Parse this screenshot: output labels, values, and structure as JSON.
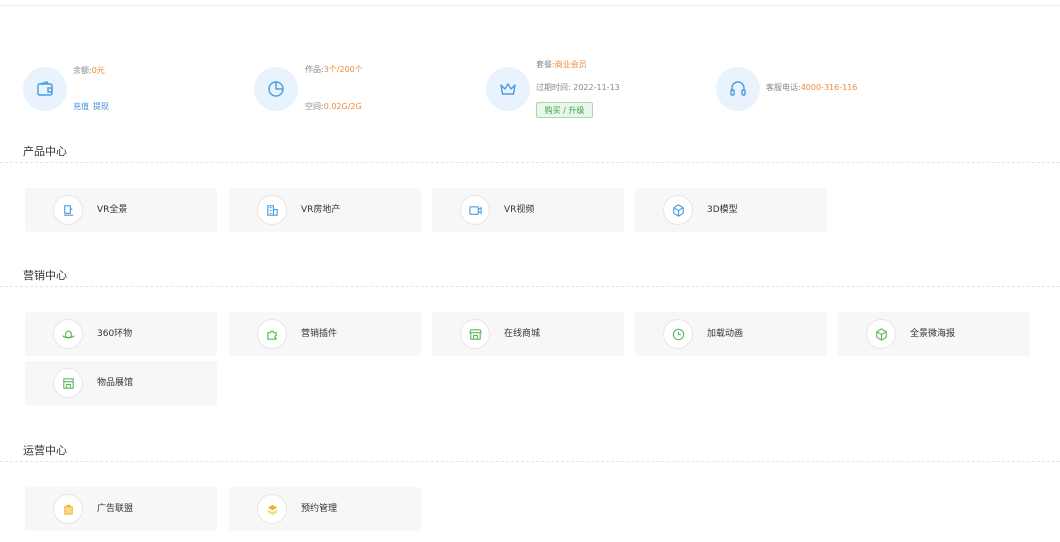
{
  "stats": {
    "balance": {
      "label": "余额:",
      "value": "0元",
      "links": [
        "充值",
        "提现"
      ]
    },
    "works": {
      "works_label": "作品:",
      "works_value": "3个/200个",
      "space_label": "空间:",
      "space_value": "0.02G/2G"
    },
    "package": {
      "label": "套餐:",
      "value": "商业会员",
      "expire_label": "过期时间:",
      "expire_value": "2022-11-13",
      "button": "购买 / 升级"
    },
    "service": {
      "label": "客服电话:",
      "value": "4000-316-116"
    }
  },
  "sections": {
    "product": {
      "title": "产品中心",
      "items": [
        {
          "label": "VR全景",
          "icon": "vr-panorama-icon"
        },
        {
          "label": "VR房地产",
          "icon": "building-icon"
        },
        {
          "label": "VR视频",
          "icon": "video-icon"
        },
        {
          "label": "3D模型",
          "icon": "cube-icon"
        }
      ]
    },
    "marketing": {
      "title": "营销中心",
      "items": [
        {
          "label": "360环物",
          "icon": "rotate-object-icon"
        },
        {
          "label": "营销插件",
          "icon": "puzzle-icon"
        },
        {
          "label": "在线商城",
          "icon": "store-icon"
        },
        {
          "label": "加载动画",
          "icon": "clock-icon"
        },
        {
          "label": "全景微海报",
          "icon": "box-icon"
        },
        {
          "label": "物品展馆",
          "icon": "exhibition-icon"
        }
      ]
    },
    "operation": {
      "title": "运营中心",
      "items": [
        {
          "label": "广告联盟",
          "icon": "ad-alliance-icon"
        },
        {
          "label": "预约管理",
          "icon": "booking-icon"
        }
      ]
    }
  },
  "colors": {
    "accent_orange": "#f08a3a",
    "link_blue": "#3d8fe0",
    "icon_blue": "#4a9de0",
    "icon_green": "#5cb85c",
    "icon_yellow": "#f0b429"
  }
}
